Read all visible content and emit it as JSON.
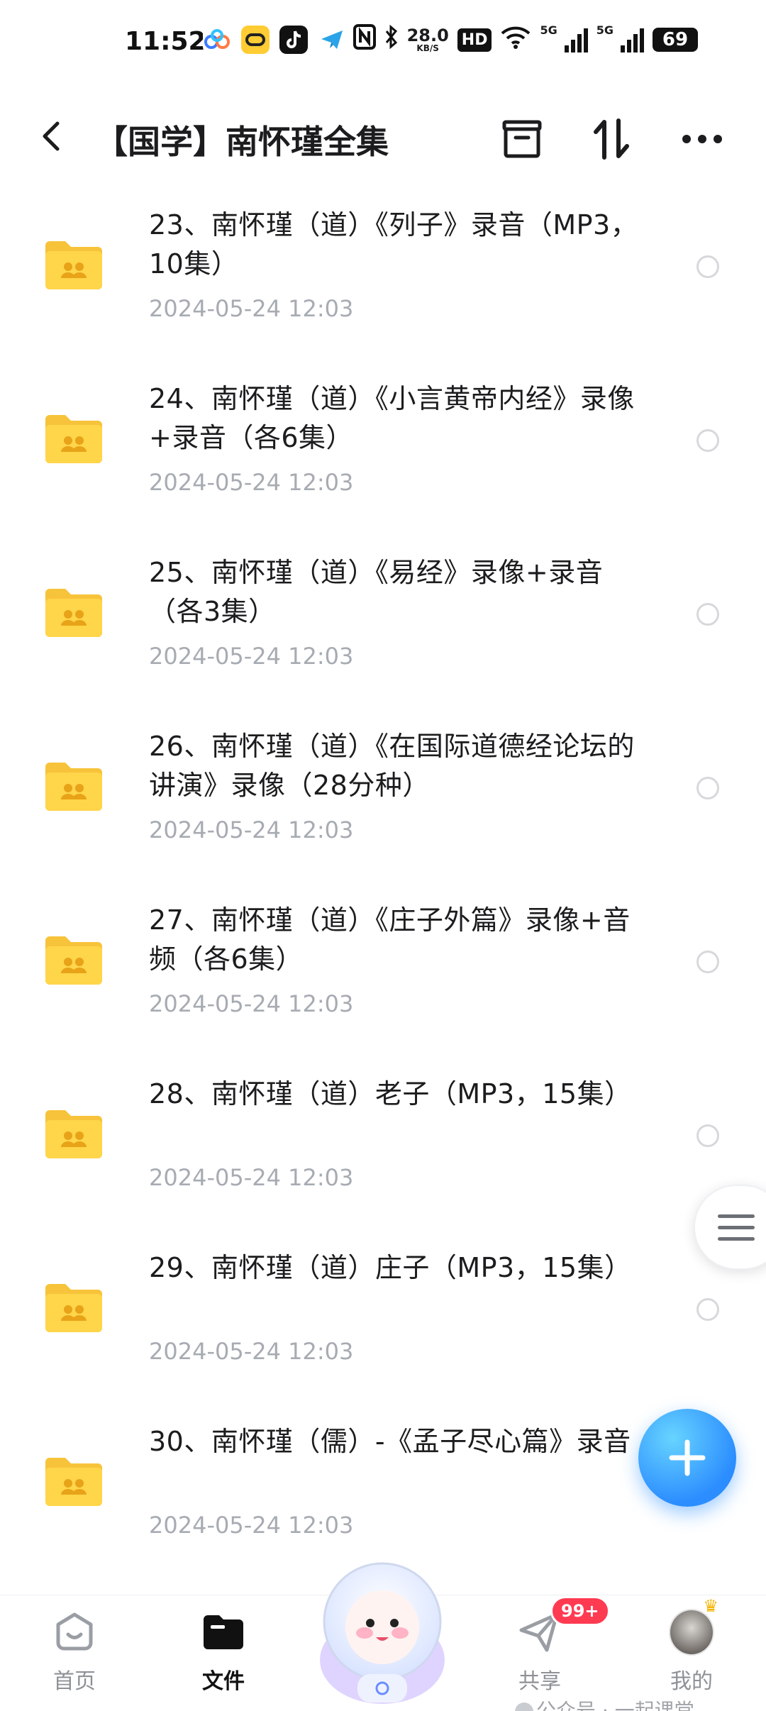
{
  "status_bar": {
    "time": "11:52",
    "speed_value": "28.0",
    "speed_unit": "KB/S",
    "hd": "HD",
    "network_1": "5G",
    "network_2": "5G",
    "battery": "69",
    "icons": [
      "baidu-netdisk-icon",
      "app-icon",
      "douyin-icon",
      "telegram-icon",
      "nfc-icon",
      "bluetooth-icon",
      "wifi-icon",
      "signal-icon",
      "battery-icon"
    ]
  },
  "header": {
    "title": "【国学】南怀瑾全集",
    "icons": [
      "back-icon",
      "archive-icon",
      "sort-icon",
      "more-icon"
    ]
  },
  "files": [
    {
      "title": "23、南怀瑾（道）《列子》录音（MP3，10集）",
      "date": "2024-05-24  12:03"
    },
    {
      "title": "24、南怀瑾（道）《小言黄帝内经》录像+录音（各6集）",
      "date": "2024-05-24  12:03"
    },
    {
      "title": "25、南怀瑾（道）《易经》录像+录音（各3集）",
      "date": "2024-05-24  12:03"
    },
    {
      "title": "26、南怀瑾（道）《在国际道德经论坛的讲演》录像（28分种）",
      "date": "2024-05-24  12:03"
    },
    {
      "title": "27、南怀瑾（道）《庄子外篇》录像+音频（各6集）",
      "date": "2024-05-24  12:03"
    },
    {
      "title": "28、南怀瑾（道）老子（MP3，15集）",
      "date": "2024-05-24  12:03"
    },
    {
      "title": "29、南怀瑾（道）庄子（MP3，15集）",
      "date": "2024-05-24  12:03"
    },
    {
      "title": "30、南怀瑾（儒）-《孟子尽心篇》录音",
      "date": "2024-05-24  12:03"
    }
  ],
  "bottom_nav": {
    "home": "首页",
    "files": "文件",
    "share": "共享",
    "badge": "99+",
    "mine": "我的"
  },
  "watermark": "公众号 · 一起课堂",
  "colors": {
    "folder": "#ffd54a",
    "fab": "#2b8dff",
    "badge": "#ff3b52",
    "date_text": "#a7abb2"
  }
}
